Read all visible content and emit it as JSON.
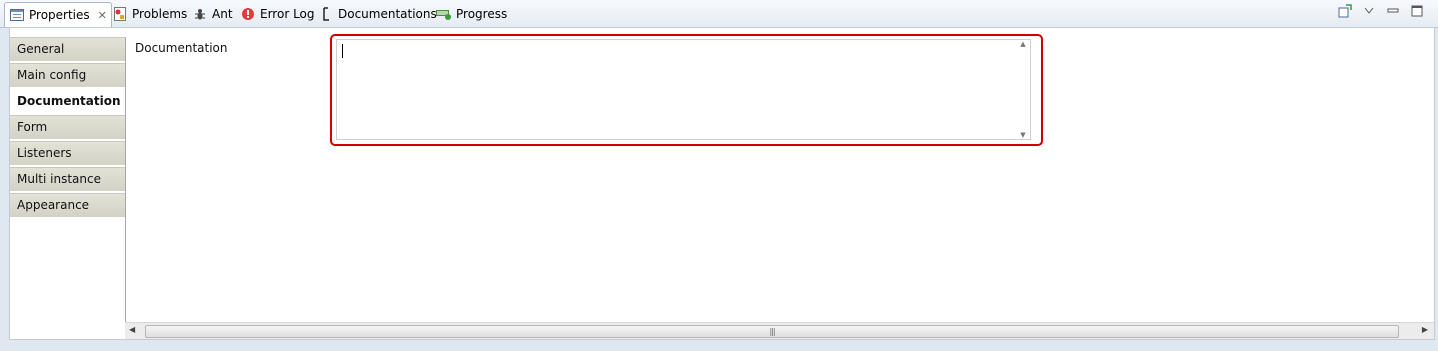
{
  "tabs": [
    {
      "label": "Properties",
      "icon": "properties-icon",
      "active": true,
      "closable": true
    },
    {
      "label": "Problems",
      "icon": "problems-icon"
    },
    {
      "label": "Ant",
      "icon": "ant-icon"
    },
    {
      "label": "Error Log",
      "icon": "error-log-icon"
    },
    {
      "label": "Documentations",
      "icon": "documentations-icon"
    },
    {
      "label": "Progress",
      "icon": "progress-icon"
    }
  ],
  "view_tools": [
    "pin-icon",
    "view-menu-icon",
    "minimize-icon",
    "maximize-icon"
  ],
  "sidebar": {
    "items": [
      {
        "label": "General"
      },
      {
        "label": "Main config"
      },
      {
        "label": "Documentation",
        "selected": true
      },
      {
        "label": "Form"
      },
      {
        "label": "Listeners"
      },
      {
        "label": "Multi instance"
      },
      {
        "label": "Appearance"
      }
    ]
  },
  "main": {
    "documentation_label": "Documentation",
    "documentation_value": ""
  },
  "colors": {
    "highlight": "#d00000",
    "selected_tab_bg": "#ffffff"
  }
}
